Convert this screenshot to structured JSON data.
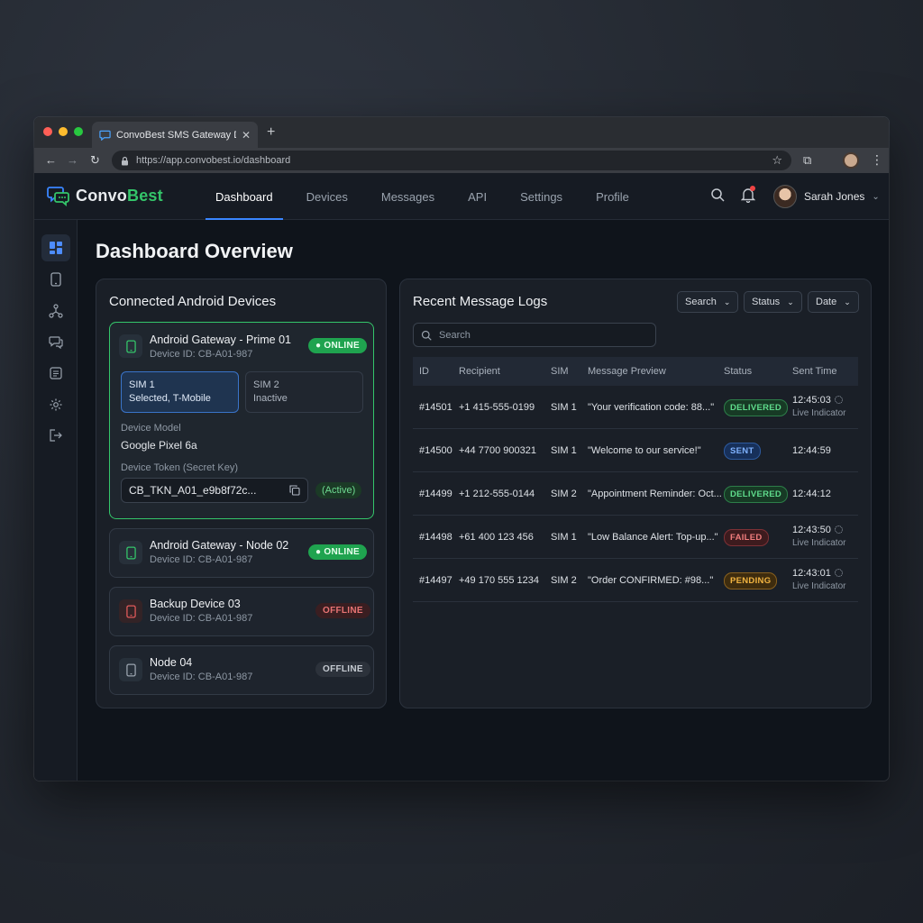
{
  "browser": {
    "tab_title": "ConvoBest SMS Gateway Das",
    "url": "https://app.convobest.io/dashboard",
    "colors": {
      "close": "#ff5f57",
      "minimize": "#febc2e",
      "maximize": "#28c840"
    }
  },
  "app": {
    "logo": {
      "part1": "Convo",
      "part2": "Best"
    },
    "nav": [
      "Dashboard",
      "Devices",
      "Messages",
      "API",
      "Settings",
      "Profile"
    ],
    "active_nav": "Dashboard",
    "user_name": "Sarah Jones",
    "accent": "#3a86ff",
    "brand_green": "#34c56a"
  },
  "sidebar": {
    "icons": [
      "dashboard-icon",
      "phone-icon",
      "network-icon",
      "messages-icon",
      "logs-icon",
      "gear-icon",
      "logout-icon"
    ]
  },
  "page": {
    "title": "Dashboard Overview"
  },
  "devices": {
    "title": "Connected Android Devices",
    "items": [
      {
        "name": "Android Gateway - Prime 01",
        "id": "Device ID: CB-A01-987",
        "status": "ONLINE",
        "sim1": {
          "title": "SIM 1",
          "detail": "Selected, T-Mobile"
        },
        "sim2": {
          "title": "SIM 2",
          "detail": "Inactive"
        },
        "model_label": "Device Model",
        "model": "Google Pixel 6a",
        "token_label": "Device Token (Secret Key)",
        "token": "CB_TKN_A01_e9b8f72c...",
        "token_status": "(Active)"
      },
      {
        "name": "Android Gateway - Node 02",
        "id": "Device ID: CB-A01-987",
        "status": "ONLINE"
      },
      {
        "name": "Backup Device 03",
        "id": "Device ID: CB-A01-987",
        "status": "OFFLINE"
      },
      {
        "name": "Node 04",
        "id": "Device ID: CB-A01-987",
        "status": "OFFLINE"
      }
    ]
  },
  "logs": {
    "title": "Recent Message Logs",
    "filters": [
      "Search",
      "Status",
      "Date"
    ],
    "search_placeholder": "Search",
    "columns": [
      "ID",
      "Recipient",
      "SIM",
      "Message Preview",
      "Status",
      "Sent Time"
    ],
    "rows": [
      {
        "id": "#14501",
        "recipient": "+1 415-555-0199",
        "sim": "SIM 1",
        "preview": "\"Your verification code: 88...\"",
        "status": "DELIVERED",
        "time": "12:45:03",
        "live": "Live Indicator"
      },
      {
        "id": "#14500",
        "recipient": "+44 7700 900321",
        "sim": "SIM 1",
        "preview": "\"Welcome to our service!\"",
        "status": "SENT",
        "time": "12:44:59",
        "live": ""
      },
      {
        "id": "#14499",
        "recipient": "+1 212-555-0144",
        "sim": "SIM 2",
        "preview": "\"Appointment Reminder: Oct...",
        "status": "DELIVERED",
        "time": "12:44:12",
        "live": ""
      },
      {
        "id": "#14498",
        "recipient": "+61 400 123 456",
        "sim": "SIM 1",
        "preview": "\"Low Balance Alert: Top-up...\"",
        "status": "FAILED",
        "time": "12:43:50",
        "live": "Live Indicator"
      },
      {
        "id": "#14497",
        "recipient": "+49 170 555 1234",
        "sim": "SIM 2",
        "preview": "\"Order CONFIRMED: #98...\"",
        "status": "PENDING",
        "time": "12:43:01",
        "live": "Live Indicator"
      }
    ]
  }
}
